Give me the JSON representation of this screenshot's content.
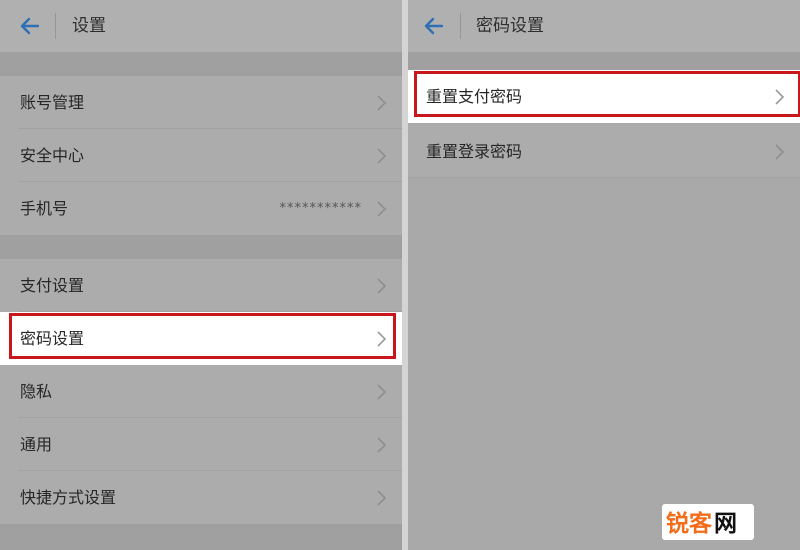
{
  "left": {
    "title": "设置",
    "rows": [
      {
        "label": "账号管理",
        "value": ""
      },
      {
        "label": "安全中心",
        "value": ""
      },
      {
        "label": "手机号",
        "value": "***********"
      },
      {
        "label": "支付设置",
        "value": ""
      },
      {
        "label": "密码设置",
        "value": "",
        "highlighted": true
      },
      {
        "label": "隐私",
        "value": ""
      },
      {
        "label": "通用",
        "value": ""
      },
      {
        "label": "快捷方式设置",
        "value": ""
      }
    ]
  },
  "right": {
    "title": "密码设置",
    "rows": [
      {
        "label": "重置支付密码",
        "highlighted": true
      },
      {
        "label": "重置登录密码"
      }
    ]
  },
  "watermark": {
    "text": "锐客网"
  },
  "colors": {
    "accent_back_arrow": "#2f6fb5",
    "highlight_border": "#c8161d",
    "screen_background": "#a9a9a9",
    "row_background": "#acacac",
    "highlighted_row_background": "#ffffff",
    "watermark_orange": "#f26c1a",
    "watermark_black": "#111111"
  }
}
